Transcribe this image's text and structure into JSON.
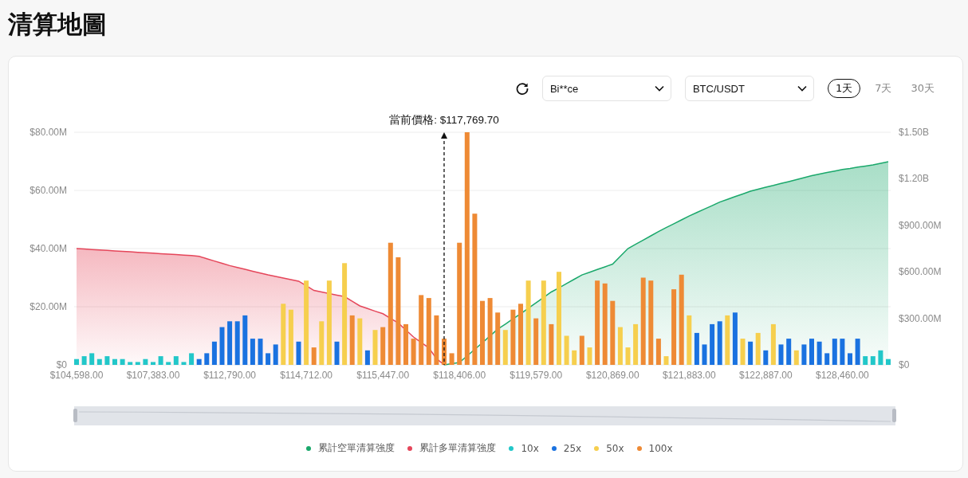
{
  "page": {
    "title": "清算地圖"
  },
  "toolbar": {
    "exchange": {
      "value": "Bi**ce"
    },
    "pair": {
      "value": "BTC/USDT"
    },
    "ranges": [
      {
        "label": "1天",
        "selected": true
      },
      {
        "label": "7天",
        "selected": false
      },
      {
        "label": "30天",
        "selected": false
      }
    ]
  },
  "chart": {
    "chart_data": {
      "type": "bar",
      "categories": [
        "$104,598.00",
        null,
        null,
        null,
        null,
        null,
        null,
        null,
        null,
        null,
        "$107,383.00",
        null,
        null,
        null,
        null,
        null,
        null,
        null,
        null,
        null,
        "$112,790.00",
        null,
        null,
        null,
        null,
        null,
        null,
        null,
        null,
        null,
        "$114,712.00",
        null,
        null,
        null,
        null,
        null,
        null,
        null,
        null,
        null,
        "$115,447.00",
        null,
        null,
        null,
        null,
        null,
        null,
        null,
        null,
        null,
        "$118,406.00",
        null,
        null,
        null,
        null,
        null,
        null,
        null,
        null,
        null,
        "$119,579.00",
        null,
        null,
        null,
        null,
        null,
        null,
        null,
        null,
        null,
        "$120,869.00",
        null,
        null,
        null,
        null,
        null,
        null,
        null,
        null,
        null,
        "$121,883.00",
        null,
        null,
        null,
        null,
        null,
        null,
        null,
        null,
        null,
        "$122,887.00",
        null,
        null,
        null,
        null,
        null,
        null,
        null,
        null,
        null,
        "$128,460.00",
        null,
        null,
        null,
        null,
        null,
        null
      ],
      "grid": true,
      "ylim": [
        0,
        80
      ],
      "yticks": [
        {
          "value": 0,
          "label": "$0"
        },
        {
          "value": 20,
          "label": "$20.00M"
        },
        {
          "value": 40,
          "label": "$40.00M"
        },
        {
          "value": 60,
          "label": "$60.00M"
        },
        {
          "value": 80,
          "label": "$80.00M"
        }
      ],
      "y2lim": [
        0,
        1500000000
      ],
      "y2ticks": [
        {
          "value": 0,
          "label": "$0"
        },
        {
          "value": 300000000,
          "label": "$300.00M"
        },
        {
          "value": 600000000,
          "label": "$600.00M"
        },
        {
          "value": 900000000,
          "label": "$900.00M"
        },
        {
          "value": 1200000000,
          "label": "$1.20B"
        },
        {
          "value": 1500000000,
          "label": "$1.50B"
        }
      ],
      "series": [
        {
          "name": "累計空單清算強度",
          "color": "#1aa86b",
          "type": "area",
          "axis": "y2",
          "values": [
            null,
            null,
            null,
            null,
            null,
            null,
            null,
            null,
            null,
            null,
            null,
            null,
            null,
            null,
            null,
            null,
            null,
            null,
            null,
            null,
            null,
            null,
            null,
            null,
            null,
            null,
            null,
            null,
            null,
            null,
            null,
            null,
            null,
            null,
            null,
            null,
            null,
            null,
            null,
            null,
            null,
            null,
            null,
            null,
            null,
            null,
            null,
            null,
            0,
            8000000,
            15000000,
            58000000,
            100000000,
            143000000,
            187000000,
            230000000,
            263000000,
            297000000,
            330000000,
            365000000,
            400000000,
            435000000,
            470000000,
            497000000,
            525000000,
            552000000,
            580000000,
            597000000,
            615000000,
            632000000,
            650000000,
            700000000,
            750000000,
            777000000,
            805000000,
            832000000,
            860000000,
            885000000,
            910000000,
            935000000,
            960000000,
            982000000,
            1005000000,
            1027000000,
            1050000000,
            1067000000,
            1085000000,
            1102000000,
            1120000000,
            1132000000,
            1145000000,
            1157000000,
            1170000000,
            1182000000,
            1195000000,
            1207000000,
            1220000000,
            1230000000,
            1240000000,
            1250000000,
            1260000000,
            1267000000,
            1275000000,
            1282000000,
            1290000000,
            1300000000,
            1310000000
          ]
        },
        {
          "name": "累計多單清算強度",
          "color": "#e5465a",
          "type": "area",
          "axis": "y2",
          "values": [
            750000000,
            747000000,
            744000000,
            741000000,
            738000000,
            735000000,
            732000000,
            729000000,
            726000000,
            723000000,
            720000000,
            717000000,
            714000000,
            711000000,
            708000000,
            705000000,
            700000000,
            685000000,
            670000000,
            655000000,
            640000000,
            628000000,
            616000000,
            604000000,
            592000000,
            580000000,
            570000000,
            560000000,
            550000000,
            540000000,
            510000000,
            480000000,
            470000000,
            460000000,
            450000000,
            440000000,
            410000000,
            380000000,
            363000000,
            346000000,
            330000000,
            300000000,
            270000000,
            225000000,
            180000000,
            145000000,
            110000000,
            40000000,
            0,
            null,
            null,
            null,
            null,
            null,
            null,
            null,
            null,
            null,
            null,
            null,
            null,
            null,
            null,
            null,
            null,
            null,
            null,
            null,
            null,
            null,
            null,
            null,
            null,
            null,
            null,
            null,
            null,
            null,
            null,
            null,
            null,
            null,
            null,
            null,
            null,
            null,
            null,
            null,
            null,
            null,
            null,
            null,
            null,
            null,
            null,
            null,
            null,
            null,
            null,
            null,
            null,
            null,
            null,
            null,
            null,
            null,
            null
          ]
        },
        {
          "name": "10x",
          "color": "#22c7c9",
          "values": [
            2,
            3,
            4,
            2,
            3,
            2,
            2,
            1,
            1,
            2,
            1,
            3,
            1,
            3,
            1,
            4,
            null,
            null,
            null,
            null,
            null,
            null,
            null,
            null,
            null,
            null,
            null,
            null,
            null,
            null,
            null,
            null,
            null,
            null,
            null,
            null,
            null,
            null,
            null,
            null,
            null,
            null,
            null,
            null,
            null,
            null,
            null,
            null,
            null,
            null,
            null,
            null,
            null,
            null,
            null,
            null,
            null,
            null,
            null,
            null,
            null,
            null,
            null,
            null,
            null,
            null,
            null,
            null,
            null,
            null,
            null,
            null,
            null,
            null,
            null,
            null,
            null,
            null,
            null,
            null,
            null,
            null,
            null,
            null,
            null,
            null,
            null,
            null,
            null,
            null,
            null,
            null,
            null,
            null,
            null,
            null,
            null,
            null,
            null,
            null,
            null,
            null,
            null,
            3,
            3,
            5,
            2
          ]
        },
        {
          "name": "25x",
          "color": "#1a72e0",
          "values": [
            null,
            null,
            null,
            null,
            null,
            null,
            null,
            null,
            null,
            null,
            null,
            null,
            null,
            null,
            null,
            null,
            2,
            4,
            8,
            13,
            15,
            15,
            17,
            9,
            9,
            4,
            7,
            null,
            null,
            8,
            null,
            null,
            null,
            null,
            8,
            null,
            null,
            null,
            5,
            null,
            null,
            null,
            null,
            null,
            null,
            null,
            null,
            null,
            null,
            null,
            null,
            null,
            null,
            null,
            null,
            null,
            null,
            null,
            null,
            null,
            null,
            null,
            null,
            null,
            null,
            null,
            null,
            null,
            null,
            null,
            null,
            null,
            null,
            null,
            null,
            null,
            null,
            null,
            null,
            null,
            null,
            11,
            7,
            14,
            15,
            null,
            18,
            null,
            8,
            null,
            5,
            null,
            7,
            9,
            null,
            7,
            9,
            8,
            4,
            9,
            9,
            4,
            9,
            null,
            null,
            null,
            null
          ]
        },
        {
          "name": "50x",
          "color": "#f6cf4e",
          "values": [
            null,
            null,
            null,
            null,
            null,
            null,
            null,
            null,
            null,
            null,
            null,
            null,
            null,
            null,
            null,
            null,
            null,
            null,
            null,
            null,
            null,
            null,
            null,
            null,
            null,
            null,
            null,
            21,
            19,
            null,
            29,
            null,
            15,
            29,
            null,
            35,
            null,
            16,
            null,
            12,
            null,
            null,
            null,
            null,
            null,
            null,
            null,
            null,
            null,
            null,
            null,
            null,
            null,
            null,
            null,
            null,
            12,
            null,
            null,
            29,
            null,
            29,
            null,
            32,
            10,
            5,
            null,
            6,
            null,
            null,
            null,
            13,
            6,
            14,
            null,
            null,
            null,
            3,
            null,
            null,
            17,
            null,
            null,
            null,
            null,
            17,
            null,
            9,
            null,
            11,
            null,
            14,
            null,
            null,
            5,
            null,
            null,
            null,
            null,
            null,
            null,
            null,
            null,
            null,
            null,
            null,
            null
          ]
        },
        {
          "name": "100x",
          "color": "#ee8a35",
          "values": [
            null,
            null,
            null,
            null,
            null,
            null,
            null,
            null,
            null,
            null,
            null,
            null,
            null,
            null,
            null,
            null,
            null,
            null,
            null,
            null,
            null,
            null,
            null,
            null,
            null,
            null,
            null,
            null,
            null,
            null,
            null,
            6,
            null,
            null,
            null,
            null,
            17,
            null,
            null,
            null,
            13,
            42,
            37,
            14,
            9,
            24,
            23,
            17,
            9,
            4,
            42,
            80,
            52,
            22,
            23,
            18,
            null,
            19,
            21,
            null,
            16,
            null,
            14,
            null,
            null,
            null,
            10,
            null,
            29,
            28,
            22,
            null,
            null,
            null,
            30,
            29,
            9,
            null,
            26,
            31,
            null,
            null,
            null,
            null,
            null,
            null,
            null,
            null,
            null,
            null,
            null,
            null,
            null,
            null,
            null,
            null,
            null,
            null,
            null,
            null,
            null,
            null,
            null,
            null,
            null,
            null,
            null
          ]
        }
      ],
      "annotations": [
        "當前價格: $117,769.70"
      ]
    },
    "range_slider": {
      "level": 1
    }
  }
}
